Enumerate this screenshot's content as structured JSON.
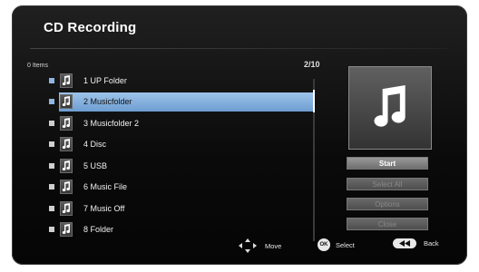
{
  "header": {
    "title": "CD Recording"
  },
  "list": {
    "count_label": "0 Items",
    "page_indicator": "2/10",
    "items": [
      {
        "label": "1  UP Folder",
        "selected": false
      },
      {
        "label": "2  Musicfolder",
        "selected": true
      },
      {
        "label": "3  Musicfolder 2",
        "selected": false
      },
      {
        "label": "4  Disc",
        "selected": false
      },
      {
        "label": "5  USB",
        "selected": false
      },
      {
        "label": "6  Music File",
        "selected": false
      },
      {
        "label": "7  Music Off",
        "selected": false
      },
      {
        "label": "8  Folder",
        "selected": false
      }
    ]
  },
  "actions": {
    "start": "Start",
    "select_all": "Select All",
    "options": "Options",
    "close": "Close"
  },
  "hints": {
    "move": "Move",
    "ok_icon_label": "OK",
    "select": "Select",
    "back": "Back"
  },
  "colors": {
    "selection": "#8fb6e0",
    "background": "#0a0a0a"
  },
  "icons": [
    "music-note-icon",
    "dpad-icon",
    "ok-button-icon",
    "rewind-button-icon"
  ]
}
